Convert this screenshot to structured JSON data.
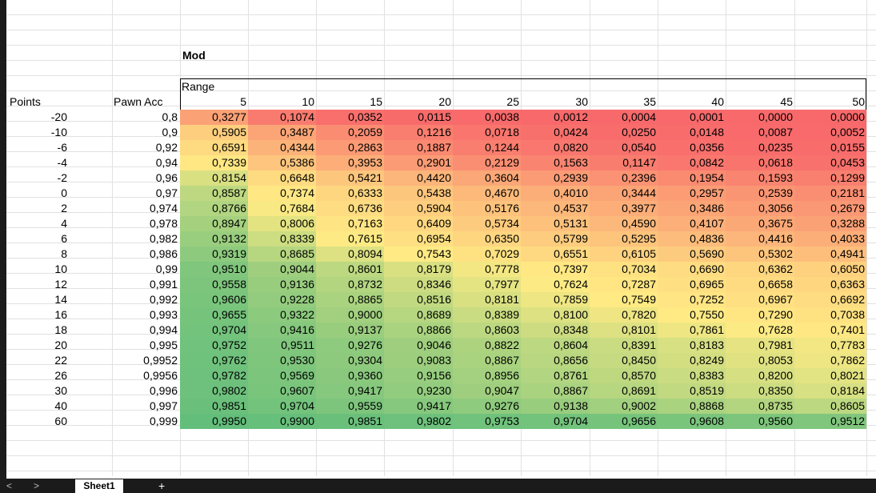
{
  "sheet": {
    "title_label": "Mod",
    "range_label": "Range",
    "points_header": "Points",
    "pawn_header": "Pawn Acc",
    "range_values": [
      "5",
      "10",
      "15",
      "20",
      "25",
      "30",
      "35",
      "40",
      "45",
      "50"
    ],
    "rows": [
      {
        "points": "-20",
        "pawn": "0,8",
        "values": [
          "0,3277",
          "0,1074",
          "0,0352",
          "0,0115",
          "0,0038",
          "0,0012",
          "0,0004",
          "0,0001",
          "0,0000",
          "0,0000"
        ]
      },
      {
        "points": "-10",
        "pawn": "0,9",
        "values": [
          "0,5905",
          "0,3487",
          "0,2059",
          "0,1216",
          "0,0718",
          "0,0424",
          "0,0250",
          "0,0148",
          "0,0087",
          "0,0052"
        ]
      },
      {
        "points": "-6",
        "pawn": "0,92",
        "values": [
          "0,6591",
          "0,4344",
          "0,2863",
          "0,1887",
          "0,1244",
          "0,0820",
          "0,0540",
          "0,0356",
          "0,0235",
          "0,0155"
        ]
      },
      {
        "points": "-4",
        "pawn": "0,94",
        "values": [
          "0,7339",
          "0,5386",
          "0,3953",
          "0,2901",
          "0,2129",
          "0,1563",
          "0,1147",
          "0,0842",
          "0,0618",
          "0,0453"
        ]
      },
      {
        "points": "-2",
        "pawn": "0,96",
        "values": [
          "0,8154",
          "0,6648",
          "0,5421",
          "0,4420",
          "0,3604",
          "0,2939",
          "0,2396",
          "0,1954",
          "0,1593",
          "0,1299"
        ]
      },
      {
        "points": "0",
        "pawn": "0,97",
        "values": [
          "0,8587",
          "0,7374",
          "0,6333",
          "0,5438",
          "0,4670",
          "0,4010",
          "0,3444",
          "0,2957",
          "0,2539",
          "0,2181"
        ]
      },
      {
        "points": "2",
        "pawn": "0,974",
        "values": [
          "0,8766",
          "0,7684",
          "0,6736",
          "0,5904",
          "0,5176",
          "0,4537",
          "0,3977",
          "0,3486",
          "0,3056",
          "0,2679"
        ]
      },
      {
        "points": "4",
        "pawn": "0,978",
        "values": [
          "0,8947",
          "0,8006",
          "0,7163",
          "0,6409",
          "0,5734",
          "0,5131",
          "0,4590",
          "0,4107",
          "0,3675",
          "0,3288"
        ]
      },
      {
        "points": "6",
        "pawn": "0,982",
        "values": [
          "0,9132",
          "0,8339",
          "0,7615",
          "0,6954",
          "0,6350",
          "0,5799",
          "0,5295",
          "0,4836",
          "0,4416",
          "0,4033"
        ]
      },
      {
        "points": "8",
        "pawn": "0,986",
        "values": [
          "0,9319",
          "0,8685",
          "0,8094",
          "0,7543",
          "0,7029",
          "0,6551",
          "0,6105",
          "0,5690",
          "0,5302",
          "0,4941"
        ]
      },
      {
        "points": "10",
        "pawn": "0,99",
        "values": [
          "0,9510",
          "0,9044",
          "0,8601",
          "0,8179",
          "0,7778",
          "0,7397",
          "0,7034",
          "0,6690",
          "0,6362",
          "0,6050"
        ]
      },
      {
        "points": "12",
        "pawn": "0,991",
        "values": [
          "0,9558",
          "0,9136",
          "0,8732",
          "0,8346",
          "0,7977",
          "0,7624",
          "0,7287",
          "0,6965",
          "0,6658",
          "0,6363"
        ]
      },
      {
        "points": "14",
        "pawn": "0,992",
        "values": [
          "0,9606",
          "0,9228",
          "0,8865",
          "0,8516",
          "0,8181",
          "0,7859",
          "0,7549",
          "0,7252",
          "0,6967",
          "0,6692"
        ]
      },
      {
        "points": "16",
        "pawn": "0,993",
        "values": [
          "0,9655",
          "0,9322",
          "0,9000",
          "0,8689",
          "0,8389",
          "0,8100",
          "0,7820",
          "0,7550",
          "0,7290",
          "0,7038"
        ]
      },
      {
        "points": "18",
        "pawn": "0,994",
        "values": [
          "0,9704",
          "0,9416",
          "0,9137",
          "0,8866",
          "0,8603",
          "0,8348",
          "0,8101",
          "0,7861",
          "0,7628",
          "0,7401"
        ]
      },
      {
        "points": "20",
        "pawn": "0,995",
        "values": [
          "0,9752",
          "0,9511",
          "0,9276",
          "0,9046",
          "0,8822",
          "0,8604",
          "0,8391",
          "0,8183",
          "0,7981",
          "0,7783"
        ]
      },
      {
        "points": "22",
        "pawn": "0,9952",
        "values": [
          "0,9762",
          "0,9530",
          "0,9304",
          "0,9083",
          "0,8867",
          "0,8656",
          "0,8450",
          "0,8249",
          "0,8053",
          "0,7862"
        ]
      },
      {
        "points": "26",
        "pawn": "0,9956",
        "values": [
          "0,9782",
          "0,9569",
          "0,9360",
          "0,9156",
          "0,8956",
          "0,8761",
          "0,8570",
          "0,8383",
          "0,8200",
          "0,8021"
        ]
      },
      {
        "points": "30",
        "pawn": "0,996",
        "values": [
          "0,9802",
          "0,9607",
          "0,9417",
          "0,9230",
          "0,9047",
          "0,8867",
          "0,8691",
          "0,8519",
          "0,8350",
          "0,8184"
        ]
      },
      {
        "points": "40",
        "pawn": "0,997",
        "values": [
          "0,9851",
          "0,9704",
          "0,9559",
          "0,9417",
          "0,9276",
          "0,9138",
          "0,9002",
          "0,8868",
          "0,8735",
          "0,8605"
        ]
      },
      {
        "points": "60",
        "pawn": "0,999",
        "values": [
          "0,9950",
          "0,9900",
          "0,9851",
          "0,9802",
          "0,9753",
          "0,9704",
          "0,9656",
          "0,9608",
          "0,9560",
          "0,9512"
        ]
      }
    ]
  },
  "colors": {
    "low": "#f8696b",
    "mid": "#ffeb84",
    "high": "#63be7b"
  },
  "tabs": {
    "active_sheet": "Sheet1",
    "add_label": "+",
    "prev_label": "<",
    "next_label": ">"
  }
}
